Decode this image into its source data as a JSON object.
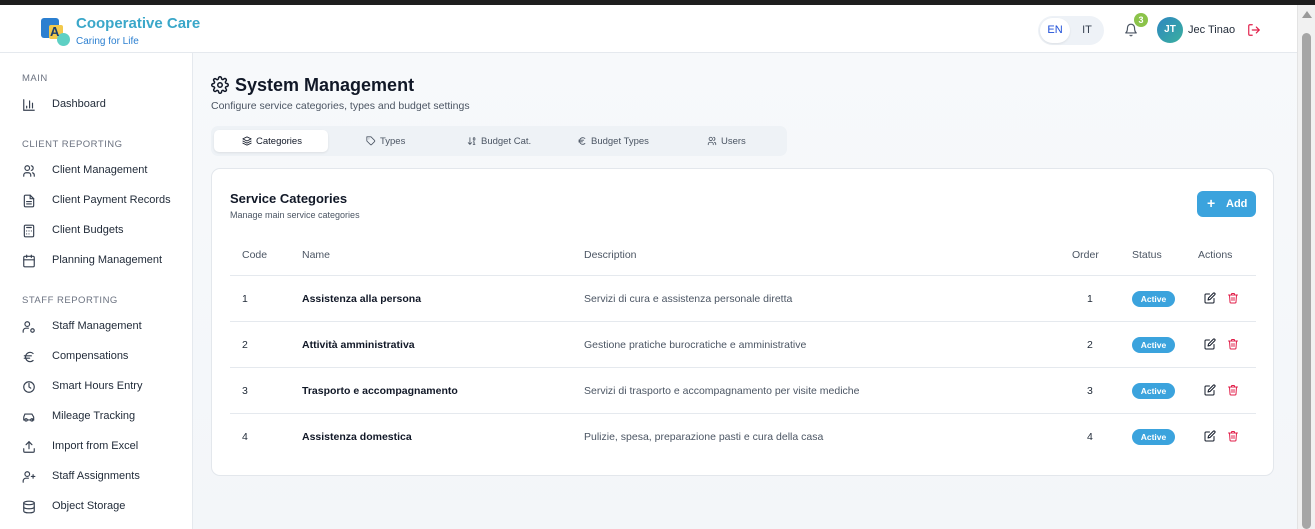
{
  "brand": {
    "title": "Cooperative Care",
    "subtitle": "Caring for Life",
    "logo_letter": "A"
  },
  "header": {
    "languages": [
      "EN",
      "IT"
    ],
    "active_language": "EN",
    "notification_count": "3",
    "user_initials": "JT",
    "user_name": "Jec Tinao"
  },
  "sidebar": {
    "sections": [
      {
        "label": "MAIN",
        "items": [
          {
            "label": "Dashboard",
            "icon": "bar-chart-icon"
          }
        ]
      },
      {
        "label": "CLIENT REPORTING",
        "items": [
          {
            "label": "Client Management",
            "icon": "users-icon"
          },
          {
            "label": "Client Payment Records",
            "icon": "file-text-icon"
          },
          {
            "label": "Client Budgets",
            "icon": "calculator-icon"
          },
          {
            "label": "Planning Management",
            "icon": "calendar-icon"
          }
        ]
      },
      {
        "label": "STAFF REPORTING",
        "items": [
          {
            "label": "Staff Management",
            "icon": "user-cog-icon"
          },
          {
            "label": "Compensations",
            "icon": "euro-icon"
          },
          {
            "label": "Smart Hours Entry",
            "icon": "clock-icon"
          },
          {
            "label": "Mileage Tracking",
            "icon": "car-icon"
          },
          {
            "label": "Import from Excel",
            "icon": "upload-icon"
          },
          {
            "label": "Staff Assignments",
            "icon": "user-plus-icon"
          },
          {
            "label": "Object Storage",
            "icon": "database-icon"
          }
        ]
      }
    ]
  },
  "page": {
    "title": "System Management",
    "subtitle": "Configure service categories, types and budget settings",
    "tabs": [
      {
        "label": "Categories",
        "icon": "layers-icon",
        "active": true
      },
      {
        "label": "Types",
        "icon": "tag-icon",
        "active": false
      },
      {
        "label": "Budget Cat.",
        "icon": "sort-icon",
        "active": false
      },
      {
        "label": "Budget Types",
        "icon": "euro-icon",
        "active": false
      },
      {
        "label": "Users",
        "icon": "users-icon",
        "active": false
      }
    ]
  },
  "card": {
    "title": "Service Categories",
    "subtitle": "Manage main service categories",
    "add_label": "Add",
    "columns": [
      "Code",
      "Name",
      "Description",
      "Order",
      "Status",
      "Actions"
    ],
    "rows": [
      {
        "code": "1",
        "name": "Assistenza alla persona",
        "description": "Servizi di cura e assistenza personale diretta",
        "order": "1",
        "status": "Active"
      },
      {
        "code": "2",
        "name": "Attività amministrativa",
        "description": "Gestione pratiche burocratiche e amministrative",
        "order": "2",
        "status": "Active"
      },
      {
        "code": "3",
        "name": "Trasporto e accompagnamento",
        "description": "Servizi di trasporto e accompagnamento per visite mediche",
        "order": "3",
        "status": "Active"
      },
      {
        "code": "4",
        "name": "Assistenza domestica",
        "description": "Pulizie, spesa, preparazione pasti e cura della casa",
        "order": "4",
        "status": "Active"
      }
    ]
  },
  "colors": {
    "accent": "#3ba3dd",
    "brand": "#3aa7c9",
    "danger": "#e11d48",
    "badge": "#8bc34a"
  }
}
